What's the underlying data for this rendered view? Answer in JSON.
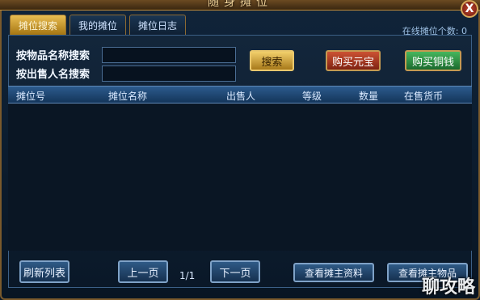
{
  "window": {
    "title": "随身摊位",
    "close_label": "X"
  },
  "tabs": [
    {
      "label": "摊位搜索",
      "active": true
    },
    {
      "label": "我的摊位",
      "active": false
    },
    {
      "label": "摊位日志",
      "active": false
    }
  ],
  "online_count": "在线摊位个数: 0",
  "search": {
    "item_label": "按物品名称搜索",
    "item_value": "",
    "seller_label": "按出售人名搜索",
    "seller_value": "",
    "search_button": "搜索",
    "buy_yuanbao_button": "购买元宝",
    "buy_copper_button": "购买铜钱"
  },
  "table": {
    "columns": [
      "摊位号",
      "摊位名称",
      "出售人",
      "等级",
      "数量",
      "在售货币"
    ],
    "rows": []
  },
  "footer": {
    "refresh_button": "刷新列表",
    "prev_button": "上一页",
    "page_indicator": "1/1",
    "next_button": "下一页",
    "view_info_button": "查看摊主资料",
    "view_items_button": "查看摊主物品"
  },
  "watermark": "聊攻略",
  "colors": {
    "gold": "#e9bd52",
    "red": "#cc5233",
    "green": "#46b65d",
    "header": "#2c5b8d"
  }
}
